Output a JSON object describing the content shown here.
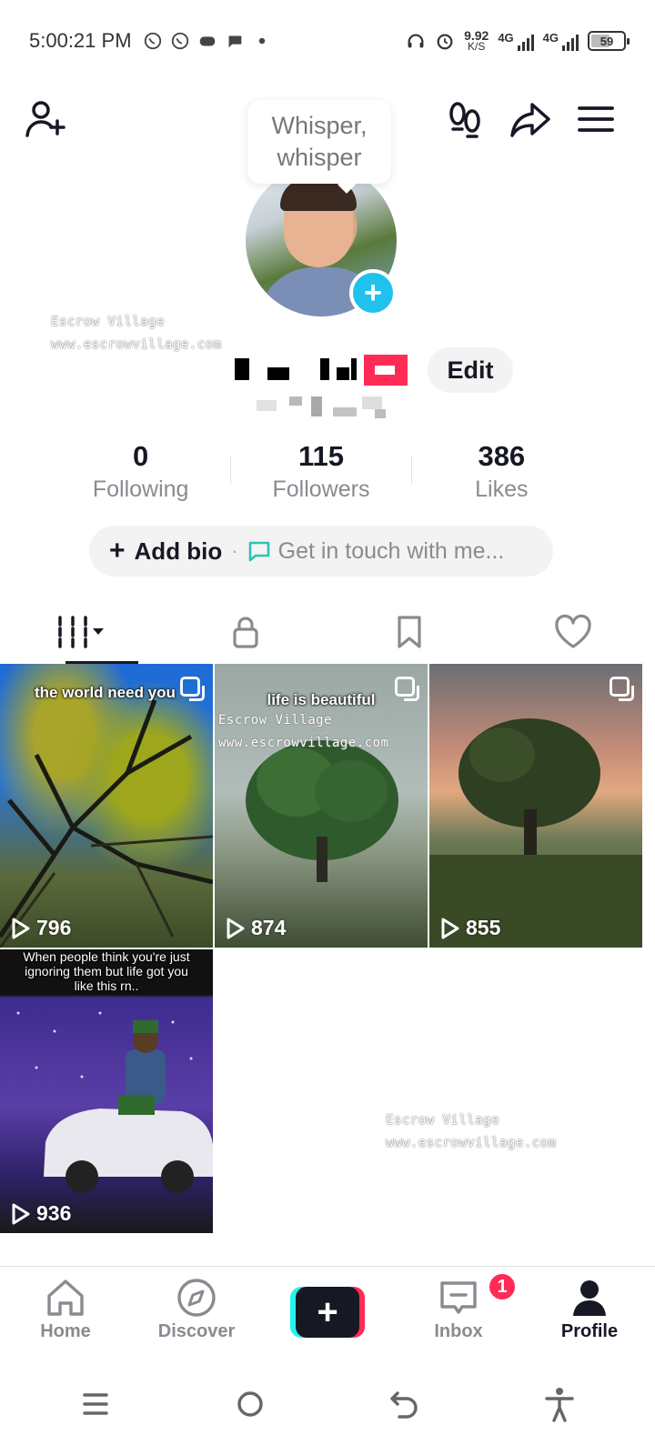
{
  "status_bar": {
    "time": "5:00:21 PM",
    "net_speed_value": "9.92",
    "net_speed_unit": "K/S",
    "network_1": "4G",
    "network_2": "4G",
    "battery": "59",
    "battery_level": 0.59,
    "icons": [
      "whatsapp-icon",
      "whatsapp-business-icon",
      "game-controller-icon",
      "chat-bubble-icon",
      "dot-icon",
      "headphones-icon",
      "alarm-icon",
      "signal-icon",
      "battery-icon"
    ]
  },
  "top_bar": {
    "icons": [
      "add-friend-icon",
      "footprints-icon",
      "share-icon",
      "menu-icon"
    ]
  },
  "tooltip": {
    "line1": "Whisper,",
    "line2": "whisper"
  },
  "profile": {
    "edit_label": "Edit",
    "add_avatar_label": "+"
  },
  "watermark": {
    "line1": "Escrow Village",
    "line2": "www.escrowvillage.com"
  },
  "stats": [
    {
      "value": "0",
      "label": "Following"
    },
    {
      "value": "115",
      "label": "Followers"
    },
    {
      "value": "386",
      "label": "Likes"
    }
  ],
  "bio": {
    "add_label": "Add bio",
    "separator": "·",
    "contact_label": "Get in touch with me..."
  },
  "tabs": [
    {
      "icon": "videos-grid-icon",
      "active": true
    },
    {
      "icon": "lock-icon",
      "active": false
    },
    {
      "icon": "bookmark-icon",
      "active": false
    },
    {
      "icon": "heart-icon",
      "active": false
    }
  ],
  "videos": [
    {
      "caption": "the world need you",
      "views": "796"
    },
    {
      "caption": "life is beautiful",
      "views": "874"
    },
    {
      "caption": "",
      "views": "855"
    },
    {
      "caption": "When people think you're just ignoring them but life got you like this rn..",
      "views": "936"
    }
  ],
  "bottom_nav": {
    "home": "Home",
    "discover": "Discover",
    "create": "+",
    "inbox": "Inbox",
    "inbox_badge": "1",
    "profile": "Profile"
  },
  "system_nav": {
    "icons": [
      "recents-icon",
      "home-circle-icon",
      "back-icon",
      "accessibility-icon"
    ]
  },
  "colors": {
    "accent_red": "#fe2c55",
    "accent_cyan": "#25f4ee",
    "avatar_add": "#20c1ed",
    "text_primary": "#161823",
    "text_secondary": "#8a8b91"
  }
}
